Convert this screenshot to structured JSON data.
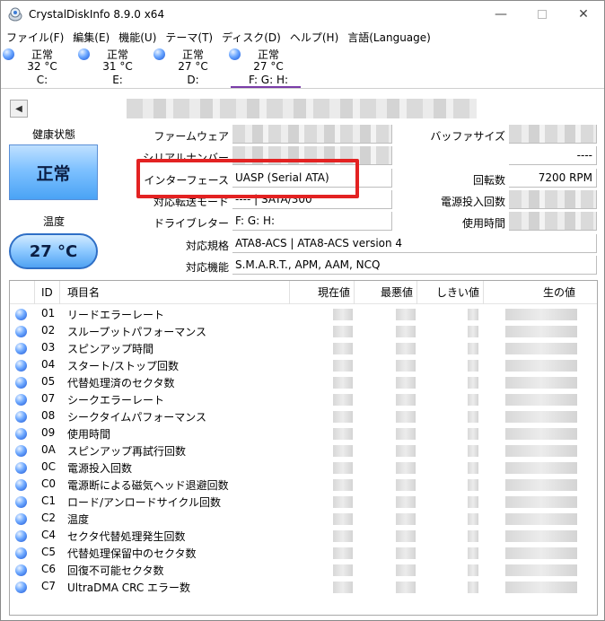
{
  "window": {
    "title": "CrystalDiskInfo 8.9.0 x64",
    "minimize": "—",
    "close": "✕"
  },
  "menu": [
    "ファイル(F)",
    "編集(E)",
    "機能(U)",
    "テーマ(T)",
    "ディスク(D)",
    "ヘルプ(H)",
    "言語(Language)"
  ],
  "drives": [
    {
      "status": "正常",
      "temp": "32 °C",
      "letter": "C:"
    },
    {
      "status": "正常",
      "temp": "31 °C",
      "letter": "E:"
    },
    {
      "status": "正常",
      "temp": "27 °C",
      "letter": "D:"
    },
    {
      "status": "正常",
      "temp": "27 °C",
      "letter": "F: G: H:"
    }
  ],
  "info": {
    "prev_arrow": "◀",
    "health_label": "健康状態",
    "health_value": "正常",
    "temp_label": "温度",
    "temp_value": "27 °C",
    "firmware_label": "ファームウェア",
    "serial_label": "シリアルナンバー",
    "interface_label": "インターフェース",
    "interface_value": "UASP (Serial ATA)",
    "transfer_label": "対応転送モード",
    "transfer_value": "---- | SATA/300",
    "drive_letter_label": "ドライブレター",
    "drive_letter_value": "F: G: H:",
    "standard_label": "対応規格",
    "standard_value": "ATA8-ACS | ATA8-ACS version 4",
    "features_label": "対応機能",
    "features_value": "S.M.A.R.T., APM, AAM, NCQ",
    "buffer_label": "バッファサイズ",
    "blank_value": "----",
    "rotation_label": "回転数",
    "rotation_value": "7200 RPM",
    "power_count_label": "電源投入回数",
    "power_hours_label": "使用時間"
  },
  "smart": {
    "headers": {
      "id": "ID",
      "name": "項目名",
      "current": "現在値",
      "worst": "最悪値",
      "threshold": "しきい値",
      "raw": "生の値"
    },
    "rows": [
      {
        "id": "01",
        "name": "リードエラーレート"
      },
      {
        "id": "02",
        "name": "スループットパフォーマンス"
      },
      {
        "id": "03",
        "name": "スピンアップ時間"
      },
      {
        "id": "04",
        "name": "スタート/ストップ回数"
      },
      {
        "id": "05",
        "name": "代替処理済のセクタ数"
      },
      {
        "id": "07",
        "name": "シークエラーレート"
      },
      {
        "id": "08",
        "name": "シークタイムパフォーマンス"
      },
      {
        "id": "09",
        "name": "使用時間"
      },
      {
        "id": "0A",
        "name": "スピンアップ再試行回数"
      },
      {
        "id": "0C",
        "name": "電源投入回数"
      },
      {
        "id": "C0",
        "name": "電源断による磁気ヘッド退避回数"
      },
      {
        "id": "C1",
        "name": "ロード/アンロードサイクル回数"
      },
      {
        "id": "C2",
        "name": "温度"
      },
      {
        "id": "C4",
        "name": "セクタ代替処理発生回数"
      },
      {
        "id": "C5",
        "name": "代替処理保留中のセクタ数"
      },
      {
        "id": "C6",
        "name": "回復不可能セクタ数"
      },
      {
        "id": "C7",
        "name": "UltraDMA CRC エラー数"
      }
    ]
  }
}
